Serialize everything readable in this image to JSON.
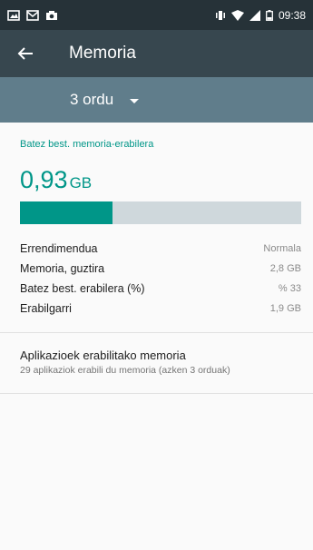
{
  "status_bar": {
    "time": "09:38",
    "left_icons": [
      "image-icon",
      "mail-icon",
      "camera-icon"
    ],
    "right_icons": [
      "vibrate-icon",
      "wifi-icon",
      "signal-icon",
      "battery-icon"
    ]
  },
  "toolbar": {
    "title": "Memoria",
    "back_icon": "arrow-back-icon"
  },
  "period": {
    "selected": "3 ordu"
  },
  "memory": {
    "section_title": "Batez best. memoria-erabilera",
    "average_value": "0,93",
    "average_unit": "GB",
    "usage_fraction": 0.33,
    "rows": [
      {
        "label": "Errendimendua",
        "value": "Normala"
      },
      {
        "label": "Memoria, guztira",
        "value": "2,8 GB"
      },
      {
        "label": "Batez best. erabilera (%)",
        "value": "% 33"
      },
      {
        "label": "Erabilgarri",
        "value": "1,9 GB"
      }
    ]
  },
  "apps": {
    "title": "Aplikazioek erabilitako memoria",
    "subtitle": "29 aplikaziok erabili du memoria (azken 3 orduak)"
  },
  "colors": {
    "status_bar": "#263238",
    "toolbar": "#37474f",
    "subbar": "#607d8b",
    "accent": "#009688",
    "bar_track": "#cfd8dc"
  }
}
